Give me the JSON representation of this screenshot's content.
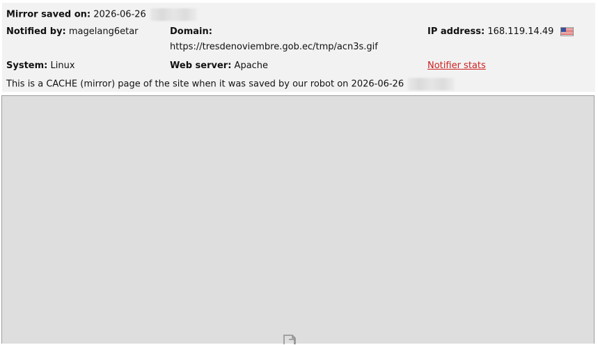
{
  "header": {
    "mirror_saved_label": "Mirror saved on:",
    "mirror_saved_value": "2026-06-26",
    "notified_by_label": "Notified by:",
    "notified_by_value": "magelang6etar",
    "domain_label": "Domain:",
    "domain_value": "https://tresdenoviembre.gob.ec/tmp/acn3s.gif",
    "ip_label": "IP address:",
    "ip_value": "168.119.14.49",
    "system_label": "System:",
    "system_value": "Linux",
    "web_server_label": "Web server:",
    "web_server_value": "Apache",
    "notifier_stats_link": "Notifier stats",
    "cache_note": "This is a CACHE (mirror) page of the site when it was saved by our robot on 2026-06-26",
    "flag_icon": "us-flag-icon"
  },
  "colors": {
    "header_background": "#f2f2f2",
    "link": "#cc2020",
    "viewport_background": "#dedede"
  }
}
